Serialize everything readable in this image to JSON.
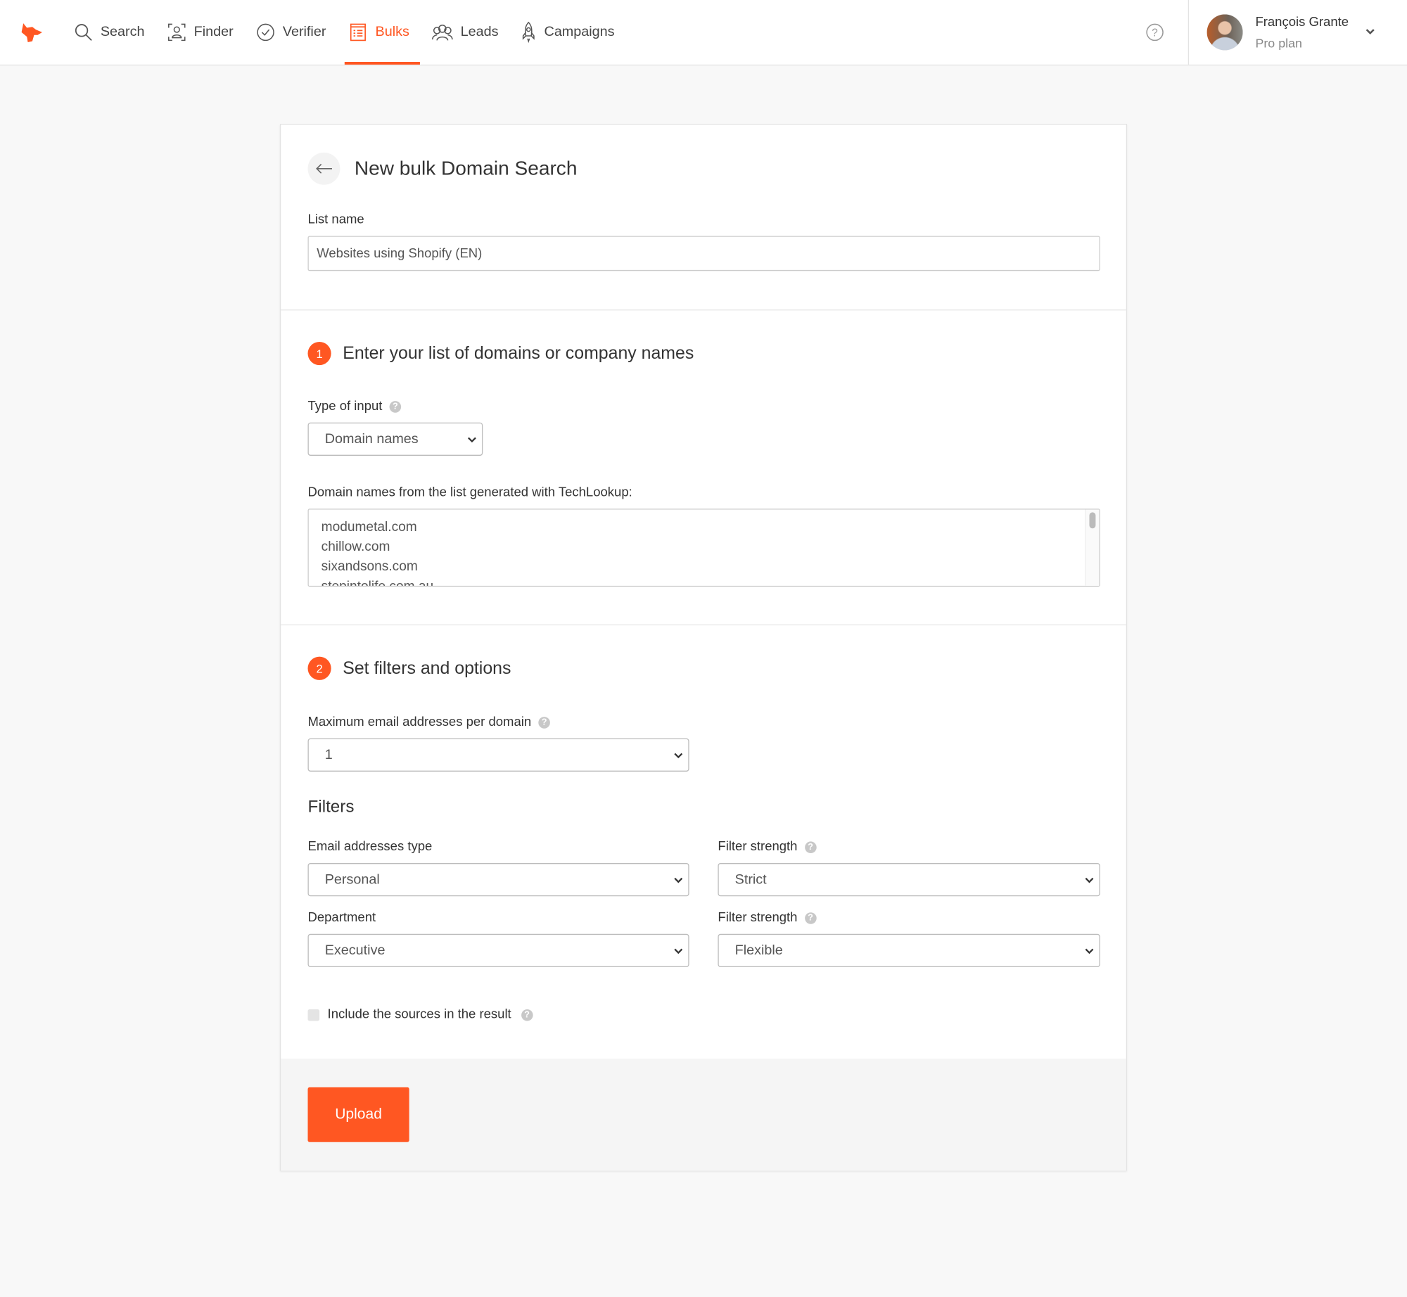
{
  "nav": {
    "items": [
      {
        "label": "Search",
        "icon": "search-icon"
      },
      {
        "label": "Finder",
        "icon": "finder-icon"
      },
      {
        "label": "Verifier",
        "icon": "check-circle-icon"
      },
      {
        "label": "Bulks",
        "icon": "list-icon",
        "active": true
      },
      {
        "label": "Leads",
        "icon": "people-icon"
      },
      {
        "label": "Campaigns",
        "icon": "rocket-icon"
      }
    ]
  },
  "user": {
    "name": "François Grante",
    "plan": "Pro plan"
  },
  "colors": {
    "accent": "#ff5722"
  },
  "page": {
    "title": "New bulk Domain Search",
    "list_name_label": "List name",
    "list_name_value": "Websites using Shopify (EN)"
  },
  "step1": {
    "number": "1",
    "title": "Enter your list of domains or company names",
    "type_label": "Type of input",
    "type_value": "Domain names",
    "domains_label": "Domain names from the list generated with TechLookup:",
    "domains": [
      "modumetal.com",
      "chillow.com",
      "sixandsons.com",
      "stepintolife.com.au"
    ]
  },
  "step2": {
    "number": "2",
    "title": "Set filters and options",
    "max_label": "Maximum email addresses per domain",
    "max_value": "1",
    "filters_heading": "Filters",
    "email_type_label": "Email addresses type",
    "email_type_value": "Personal",
    "strength1_label": "Filter strength",
    "strength1_value": "Strict",
    "department_label": "Department",
    "department_value": "Executive",
    "strength2_label": "Filter strength",
    "strength2_value": "Flexible",
    "sources_label": "Include the sources in the result"
  },
  "footer": {
    "upload_label": "Upload"
  }
}
